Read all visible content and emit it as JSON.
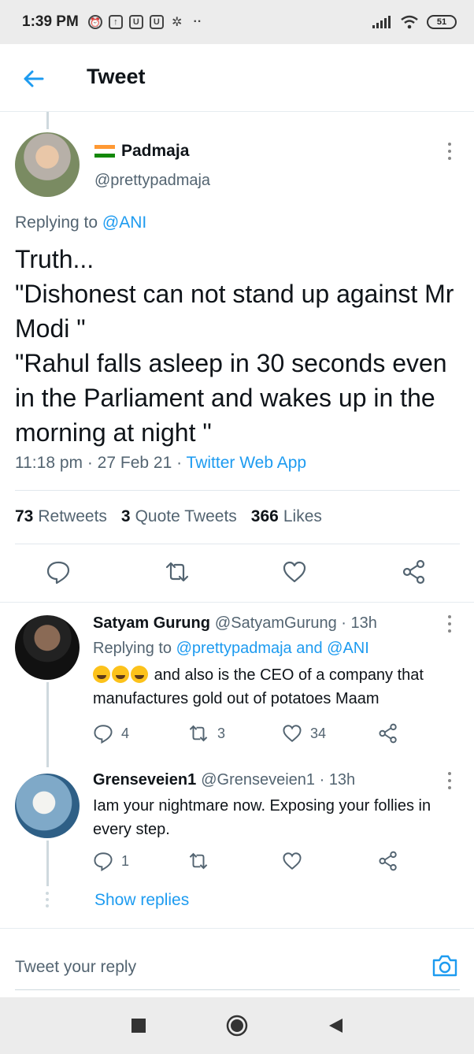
{
  "status_bar": {
    "time": "1:39 PM",
    "battery": "51"
  },
  "header": {
    "title": "Tweet"
  },
  "main_tweet": {
    "display_name": "Padmaja",
    "handle": "@prettypadmaja",
    "replying_prefix": "Replying to",
    "replying_to": "@ANI",
    "text": "Truth...\n\"Dishonest can not stand up against Mr Modi \"\n\"Rahul falls asleep in 30 seconds even in the Parliament and wakes up in the morning at night \"",
    "time": "11:18 pm",
    "date": "27 Feb 21",
    "source": "Twitter Web App",
    "stats": {
      "retweets_count": "73",
      "retweets_label": "Retweets",
      "quotes_count": "3",
      "quotes_label": "Quote Tweets",
      "likes_count": "366",
      "likes_label": "Likes"
    }
  },
  "replies": [
    {
      "display_name": "Satyam Gurung",
      "handle": "@SatyamGurung",
      "time": "13h",
      "replying_prefix": "Replying to",
      "replying_to": "@prettypadmaja and @ANI",
      "text": "and also is the CEO of a company that manufactures gold out of potatoes Maam",
      "reply_count": "4",
      "retweet_count": "3",
      "like_count": "34"
    },
    {
      "display_name": "Grenseveien1",
      "handle": "@Grenseveien1",
      "time": "13h",
      "text": "Iam your nightmare now. Exposing your follies in every step.",
      "reply_count": "1",
      "retweet_count": "",
      "like_count": ""
    }
  ],
  "show_replies": "Show replies",
  "reply_input": {
    "placeholder": "Tweet your reply"
  },
  "colors": {
    "accent": "#1d9bf0",
    "secondary_text": "#536471"
  }
}
